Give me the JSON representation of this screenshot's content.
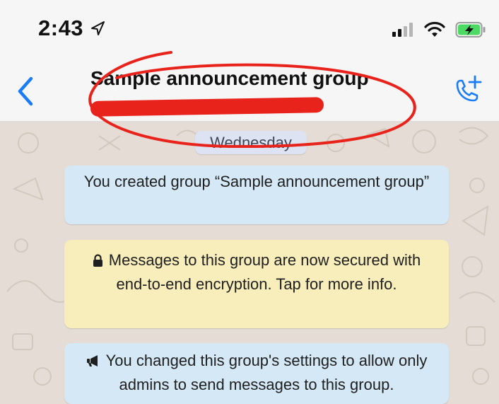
{
  "status_bar": {
    "time": "2:43"
  },
  "header": {
    "group_title": "Sample announcement group"
  },
  "chat": {
    "day_separator": "Wednesday",
    "messages": [
      {
        "text": "You created group “Sample announcement group”"
      },
      {
        "text": "Messages to this group are now secured with end-to-end encryption. Tap for more info."
      },
      {
        "text": "You changed this group's settings to allow only admins to send messages to this group."
      }
    ]
  },
  "colors": {
    "accent_blue": "#1a7cf8",
    "chat_bg": "#e5ddd5",
    "system_bubble_blue": "#d5e8f6",
    "system_bubble_yellow": "#f8eebb",
    "annotation_red": "#e8231b"
  },
  "icons": {
    "back": "chevron-left-icon",
    "call": "add-call-icon",
    "location": "location-arrow-icon",
    "signal": "signal-icon",
    "wifi": "wifi-icon",
    "battery": "battery-charging-icon",
    "lock": "lock-icon",
    "announcement": "megaphone-icon"
  }
}
